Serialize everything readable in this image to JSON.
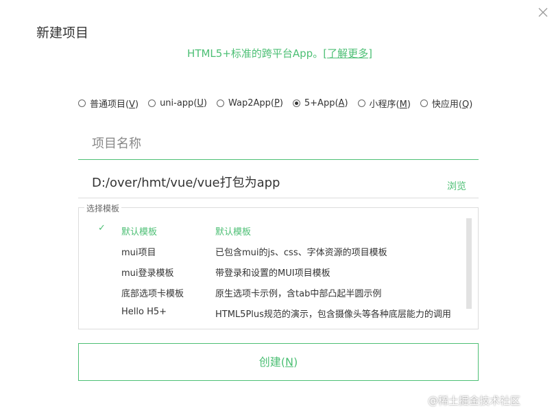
{
  "dialog": {
    "title": "新建项目",
    "subtitle_text": "HTML5+标准的跨平台App。",
    "subtitle_link": "[了解更多]"
  },
  "project_types": [
    {
      "label": "普通项目(",
      "key": "V",
      "close": ")",
      "checked": false
    },
    {
      "label": "uni-app(",
      "key": "U",
      "close": ")",
      "checked": false
    },
    {
      "label": "Wap2App(",
      "key": "P",
      "close": ")",
      "checked": false
    },
    {
      "label": "5+App(",
      "key": "A",
      "close": ")",
      "checked": true
    },
    {
      "label": "小程序(",
      "key": "M",
      "close": ")",
      "checked": false
    },
    {
      "label": "快应用(",
      "key": "Q",
      "close": ")",
      "checked": false
    }
  ],
  "form": {
    "name_placeholder": "项目名称",
    "name_value": "",
    "path": "D:/over/hmt/vue/vue打包为app",
    "browse_label": "浏览"
  },
  "templates": {
    "legend": "选择模板",
    "items": [
      {
        "check": "✓",
        "name": "默认模板",
        "desc": "默认模板",
        "selected": true
      },
      {
        "check": "",
        "name": "mui项目",
        "desc": "已包含mui的js、css、字体资源的项目模板",
        "selected": false
      },
      {
        "check": "",
        "name": "mui登录模板",
        "desc": "带登录和设置的MUI项目模板",
        "selected": false
      },
      {
        "check": "",
        "name": "底部选项卡模板",
        "desc": "原生选项卡示例，含tab中部凸起半圆示例",
        "selected": false
      },
      {
        "check": "",
        "name": "Hello H5+",
        "desc": "HTML5Plus规范的演示，包含摄像头等各种底层能力的调用",
        "selected": false
      }
    ]
  },
  "create_button": {
    "label": "创建(",
    "key": "N",
    "close": ")"
  },
  "watermark": "@稀土掘金技术社区",
  "colors": {
    "accent": "#4cbf74",
    "border": "#dcdcdc",
    "text": "#333333"
  }
}
